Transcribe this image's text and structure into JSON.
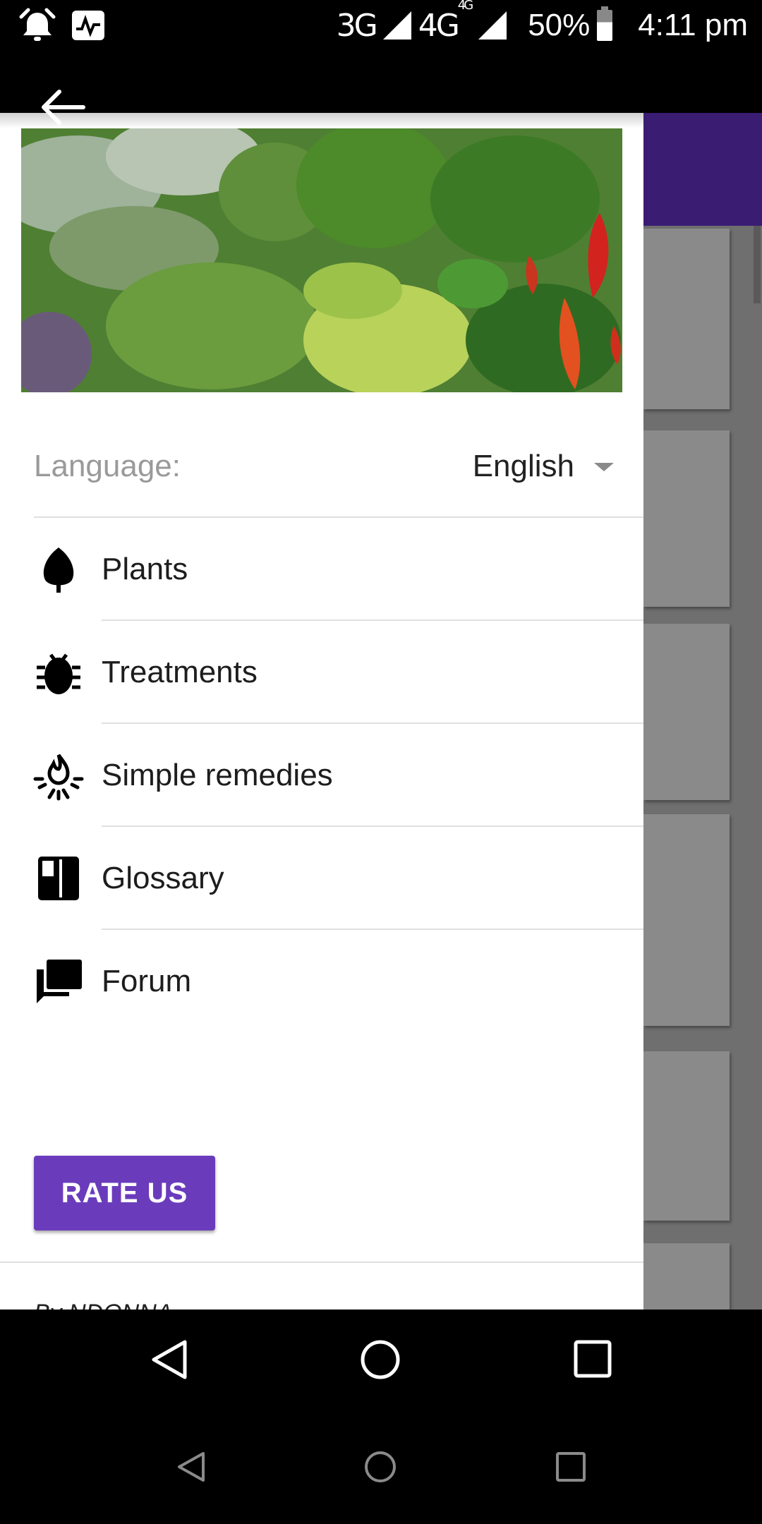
{
  "status_bar": {
    "network_3g": "3G",
    "network_4g": "4G",
    "network_4g_sup": "4G",
    "battery": "50%",
    "time": "4:11 pm",
    "icons": [
      "alarm-icon",
      "activity-icon",
      "signal-icon",
      "battery-icon"
    ]
  },
  "drawer": {
    "header_image": "herbs-and-chili-photo",
    "language": {
      "label": "Language:",
      "value": "English"
    },
    "menu": [
      {
        "label": "Plants",
        "icon": "leaf-icon"
      },
      {
        "label": "Treatments",
        "icon": "bug-icon"
      },
      {
        "label": "Simple remedies",
        "icon": "campfire-icon"
      },
      {
        "label": "Glossary",
        "icon": "book-icon"
      },
      {
        "label": "Forum",
        "icon": "forum-icon"
      }
    ],
    "rate_button": "RATE US",
    "byline": "By NDONNA"
  },
  "colors": {
    "accent": "#6a3cbc",
    "app_bar": "#3a1c73",
    "scrim": "#6f6f6f"
  },
  "nav": {
    "buttons": [
      "back-icon",
      "home-icon",
      "recents-icon"
    ]
  }
}
